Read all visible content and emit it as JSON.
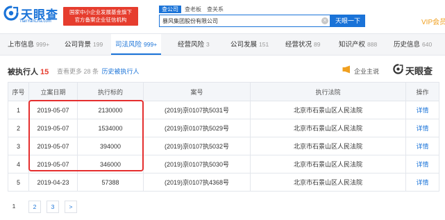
{
  "header": {
    "logo_text": "天眼查",
    "logo_url": "TianYanCha.com",
    "badge_lines": [
      "国家中小企业发展基金旗下",
      "官方备案企业征信机构"
    ],
    "search_tabs": [
      "查公司",
      "查老板",
      "查关系"
    ],
    "search_value": "暴风集团股份有限公司",
    "search_button": "天眼一下",
    "vip_label": "VIP会员"
  },
  "nav": {
    "tabs": [
      {
        "label": "上市信息",
        "count": "999+"
      },
      {
        "label": "公司背景",
        "count": "199"
      },
      {
        "label": "司法风险",
        "count": "999+",
        "active": true
      },
      {
        "label": "经营风险",
        "count": "3"
      },
      {
        "label": "公司发展",
        "count": "151"
      },
      {
        "label": "经营状况",
        "count": "89"
      },
      {
        "label": "知识产权",
        "count": "888"
      },
      {
        "label": "历史信息",
        "count": "640"
      }
    ]
  },
  "section": {
    "title": "被执行人",
    "count": "15",
    "more_text": "查看更多 28 条",
    "history_link": "历史被执行人",
    "promo_label": "企业主说",
    "brand_label": "天眼查"
  },
  "table": {
    "headers": [
      "序号",
      "立案日期",
      "执行标的",
      "案号",
      "执行法院",
      "操作"
    ],
    "rows": [
      {
        "no": "1",
        "date": "2019-05-07",
        "amount": "2130000",
        "case": "(2019)京0107执5031号",
        "court": "北京市石景山区人民法院",
        "action": "详情"
      },
      {
        "no": "2",
        "date": "2019-05-07",
        "amount": "1534000",
        "case": "(2019)京0107执5029号",
        "court": "北京市石景山区人民法院",
        "action": "详情"
      },
      {
        "no": "3",
        "date": "2019-05-07",
        "amount": "394000",
        "case": "(2019)京0107执5032号",
        "court": "北京市石景山区人民法院",
        "action": "详情"
      },
      {
        "no": "4",
        "date": "2019-05-07",
        "amount": "346000",
        "case": "(2019)京0107执5030号",
        "court": "北京市石景山区人民法院",
        "action": "详情"
      },
      {
        "no": "5",
        "date": "2019-04-23",
        "amount": "57388",
        "case": "(2019)京0107执4368号",
        "court": "北京市石景山区人民法院",
        "action": "详情"
      }
    ]
  },
  "pagination": {
    "pages": [
      "1",
      "2",
      "3"
    ],
    "current": "1",
    "next": ">"
  },
  "colors": {
    "brand_blue": "#1a73d8",
    "badge_red": "#e63d2e",
    "highlight_red": "#e52e2e",
    "vip_orange": "#f0a020"
  }
}
